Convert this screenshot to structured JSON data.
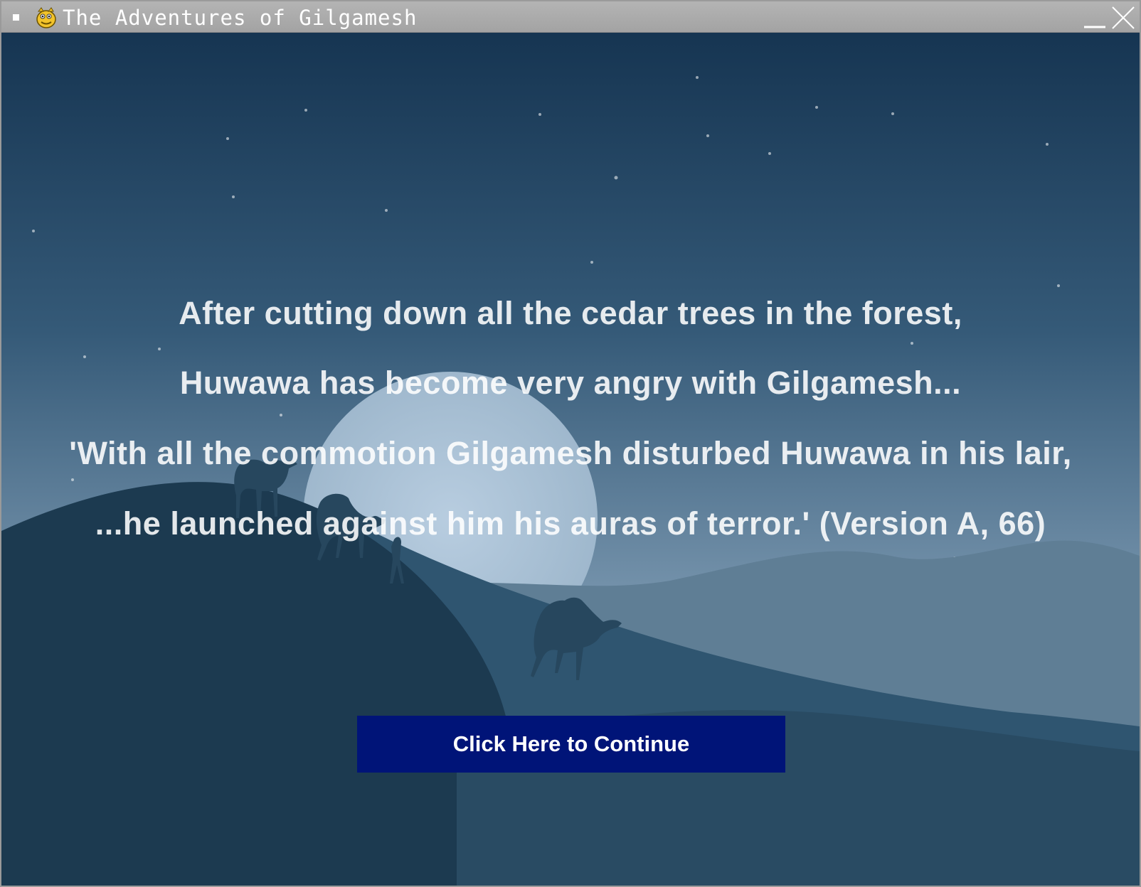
{
  "window": {
    "title": "The Adventures of Gilgamesh",
    "app_icon": "pygame-snake-icon",
    "controls": [
      "minimize-icon",
      "close-icon"
    ]
  },
  "story": {
    "lines": [
      "After cutting down all the cedar trees in the forest,",
      "Huwawa has become very angry with Gilgamesh...",
      "'With all the commotion Gilgamesh disturbed Huwawa in his lair,",
      "...he launched against him his auras of terror.' (Version A, 66)"
    ]
  },
  "continue_button": {
    "label": "Click Here to Continue",
    "color": "#001478"
  },
  "scene": {
    "description_icon": "desert-night-camels-background",
    "sky_top_color": "#163552",
    "sky_bottom_color": "#8eaac0",
    "moon_color": "#a7c0d6"
  }
}
